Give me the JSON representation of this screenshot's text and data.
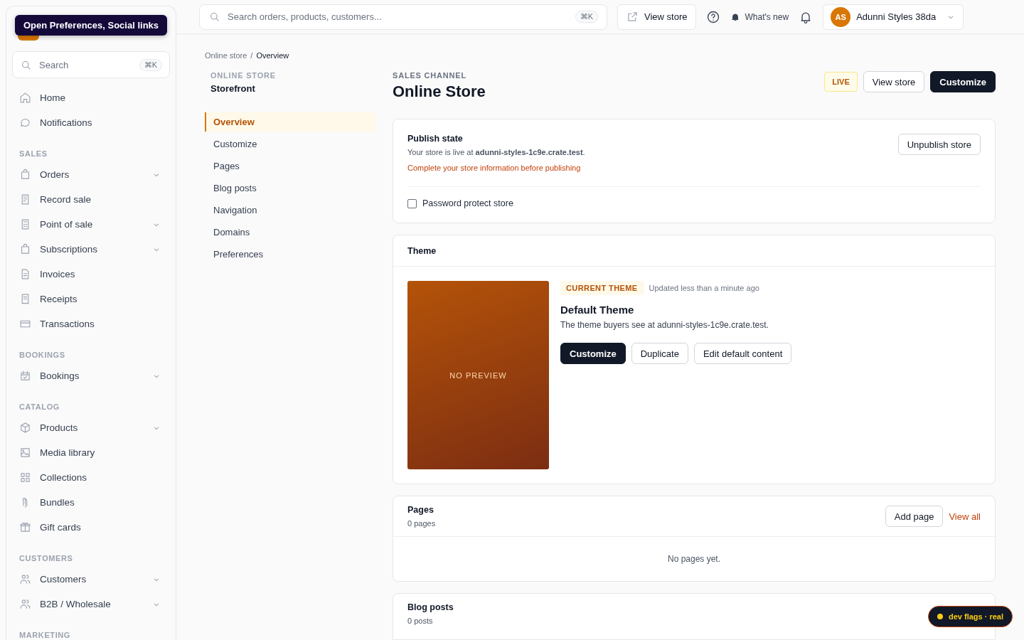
{
  "tooltip": "Open Preferences, Social links",
  "sidebar": {
    "search": {
      "placeholder": "Search",
      "shortcut": "⌘K"
    },
    "sections": [
      {
        "items": [
          {
            "label": "Home",
            "expandable": false
          },
          {
            "label": "Notifications",
            "expandable": false
          }
        ]
      },
      {
        "heading": "SALES",
        "items": [
          {
            "label": "Orders",
            "expandable": true
          },
          {
            "label": "Record sale",
            "expandable": false
          },
          {
            "label": "Point of sale",
            "expandable": true
          },
          {
            "label": "Subscriptions",
            "expandable": true
          },
          {
            "label": "Invoices",
            "expandable": false
          },
          {
            "label": "Receipts",
            "expandable": false
          },
          {
            "label": "Transactions",
            "expandable": false
          }
        ]
      },
      {
        "heading": "BOOKINGS",
        "items": [
          {
            "label": "Bookings",
            "expandable": true
          }
        ]
      },
      {
        "heading": "CATALOG",
        "items": [
          {
            "label": "Products",
            "expandable": true
          },
          {
            "label": "Media library",
            "expandable": false
          },
          {
            "label": "Collections",
            "expandable": false
          },
          {
            "label": "Bundles",
            "expandable": false
          },
          {
            "label": "Gift cards",
            "expandable": false
          }
        ]
      },
      {
        "heading": "CUSTOMERS",
        "items": [
          {
            "label": "Customers",
            "expandable": true
          },
          {
            "label": "B2B / Wholesale",
            "expandable": true
          }
        ]
      },
      {
        "heading": "MARKETING"
      }
    ]
  },
  "topbar": {
    "search": {
      "placeholder": "Search orders, products, customers...",
      "shortcut": "⌘K"
    },
    "view_store": "View store",
    "whats_new": "What's new",
    "account": {
      "initials": "AS",
      "name": "Adunni Styles 38da"
    }
  },
  "breadcrumb": [
    "Online store",
    "Overview"
  ],
  "breadcrumb_separator": "/",
  "subnav": {
    "eyebrow": "ONLINE STORE",
    "title": "Storefront",
    "items": [
      {
        "label": "Overview",
        "selected": true
      },
      {
        "label": "Customize",
        "selected": false
      },
      {
        "label": "Pages",
        "selected": false
      },
      {
        "label": "Blog posts",
        "selected": false
      },
      {
        "label": "Navigation",
        "selected": false
      },
      {
        "label": "Domains",
        "selected": false
      },
      {
        "label": "Preferences",
        "selected": false
      }
    ]
  },
  "header": {
    "eyebrow": "SALES CHANNEL",
    "title": "Online Store",
    "status": "LIVE",
    "buttons": [
      {
        "label": "View store",
        "kind": "secondary"
      },
      {
        "label": "Customize",
        "kind": "primary"
      }
    ]
  },
  "publish": {
    "title": "Publish state",
    "text": "Your store is live at **adunni-styles-1c9e.crate.test**.",
    "warning": "Complete your store information before publishing",
    "button": "Unpublish store",
    "password": {
      "label": "Password protect store",
      "checked": false
    }
  },
  "theme": {
    "title": "Theme",
    "preview": "NO PREVIEW",
    "badge": "CURRENT THEME",
    "updated": "Updated less than a minute ago",
    "name": "Default Theme",
    "description": "The theme buyers see at adunni-styles-1c9e.crate.test.",
    "buttons": [
      {
        "label": "Customize",
        "kind": "primary"
      },
      {
        "label": "Duplicate",
        "kind": "secondary"
      },
      {
        "label": "Edit default content",
        "kind": "secondary"
      }
    ]
  },
  "pages": {
    "title": "Pages",
    "count": "0 pages",
    "add": "Add page",
    "view_all": "View all",
    "empty": "No pages yet."
  },
  "blog": {
    "title": "Blog posts",
    "count": "0 posts"
  },
  "dev_badge": "dev flags · real"
}
